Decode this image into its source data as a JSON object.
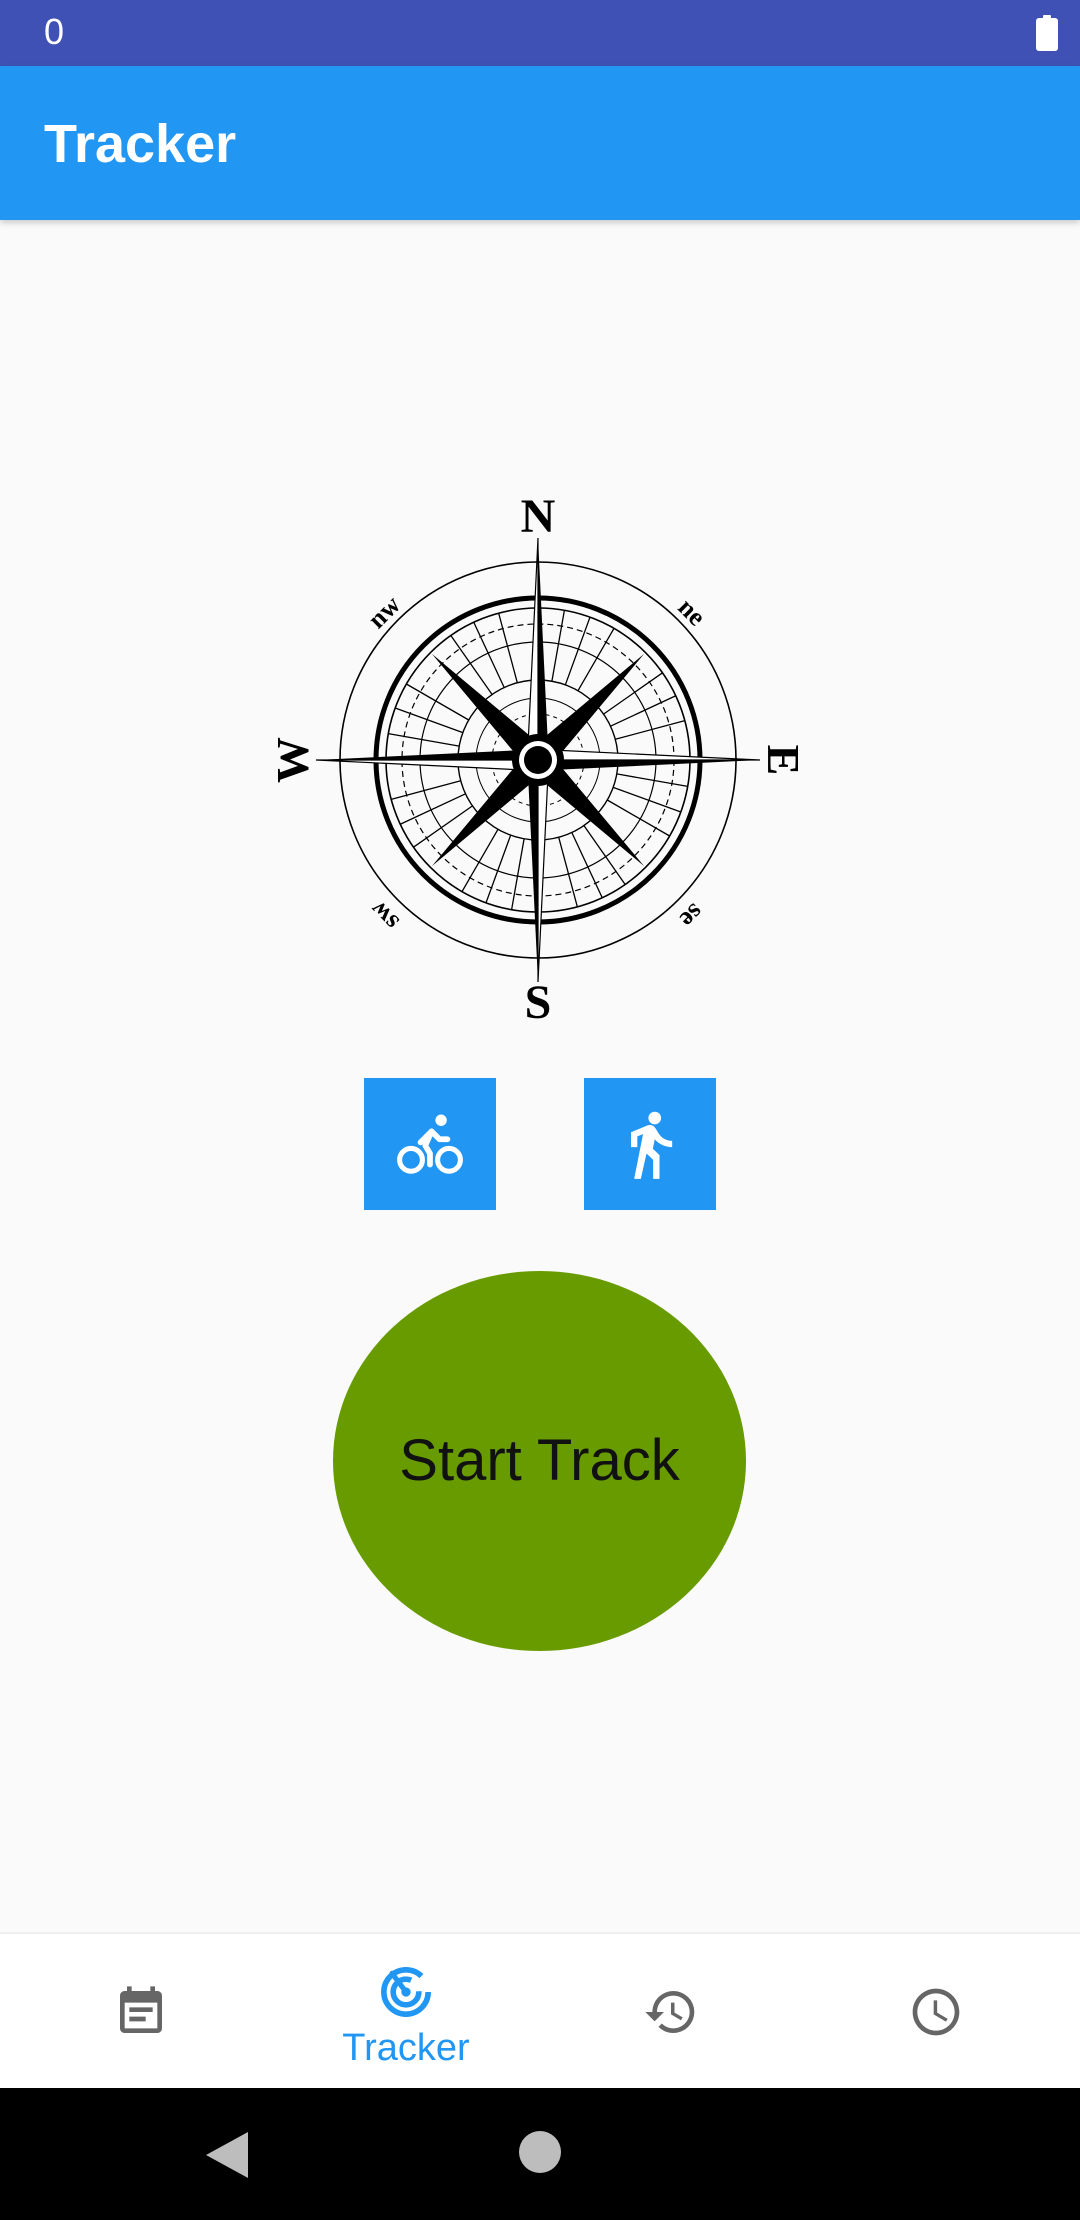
{
  "status_bar": {
    "left_text": "0",
    "battery_icon": "battery-full-icon",
    "background": "#3F51B5"
  },
  "app_bar": {
    "title": "Tracker",
    "background": "#2196F3"
  },
  "compass": {
    "icon": "compass-rose-image",
    "labels": {
      "north": "N",
      "south": "S",
      "east": "E",
      "west": "W",
      "north_east": "ne",
      "north_west": "nw",
      "south_east": "se",
      "south_west": "sw"
    }
  },
  "mode_buttons": [
    {
      "icon": "bicycle-icon"
    },
    {
      "icon": "walking-icon"
    }
  ],
  "start_button": {
    "label": "Start Track",
    "color": "#689B00"
  },
  "bottom_nav": {
    "items": [
      {
        "icon": "calendar-list-icon",
        "label": ""
      },
      {
        "icon": "radar-icon",
        "label": "Tracker",
        "active": true
      },
      {
        "icon": "history-icon",
        "label": ""
      },
      {
        "icon": "clock-icon",
        "label": ""
      }
    ],
    "active_color": "#2196F3",
    "inactive_color": "#666666"
  },
  "system_nav": {
    "back_icon": "back-triangle-icon",
    "home_icon": "home-circle-icon"
  }
}
